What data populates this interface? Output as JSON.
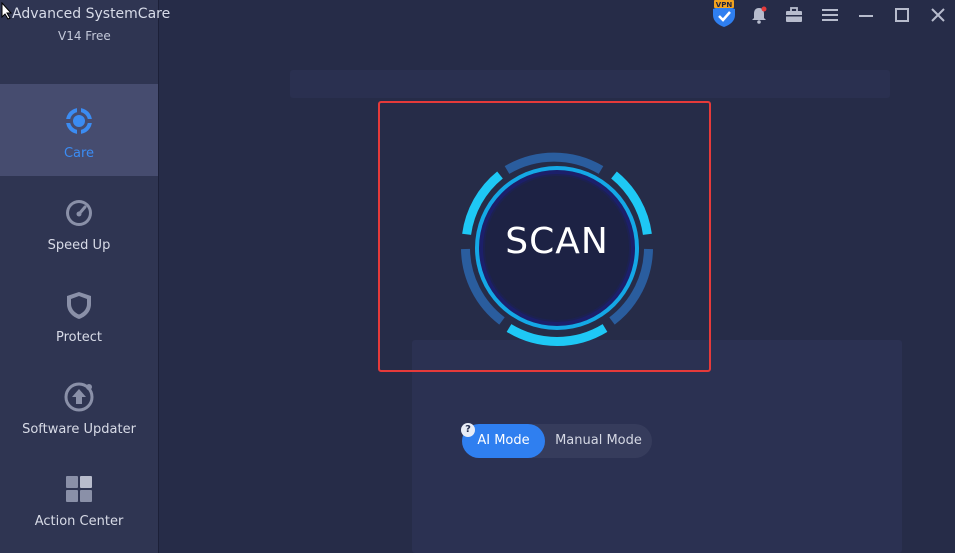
{
  "app": {
    "title": "Advanced SystemCare",
    "version": "V14 Free"
  },
  "sidebar": {
    "items": [
      {
        "label": "Care",
        "icon": "care-icon",
        "active": true
      },
      {
        "label": "Speed Up",
        "icon": "speedometer-icon",
        "active": false
      },
      {
        "label": "Protect",
        "icon": "shield-icon",
        "active": false
      },
      {
        "label": "Software Updater",
        "icon": "update-arrow-icon",
        "active": false
      },
      {
        "label": "Action Center",
        "icon": "grid-icon",
        "active": false
      }
    ]
  },
  "toolbar": {
    "vpn_label": "VPN",
    "icons": [
      "vpn-shield-icon",
      "bell-icon",
      "toolbox-icon",
      "menu-icon",
      "minimize-icon",
      "maximize-icon",
      "close-icon"
    ]
  },
  "scan": {
    "label": "SCAN"
  },
  "mode": {
    "ai_label": "AI Mode",
    "manual_label": "Manual Mode",
    "help": "?",
    "selected": "AI Mode"
  },
  "colors": {
    "accent": "#2f7ff0",
    "active_label": "#3b8cf3",
    "scan_ring": "#1ec8f5",
    "highlight_frame": "#e53a3a"
  }
}
